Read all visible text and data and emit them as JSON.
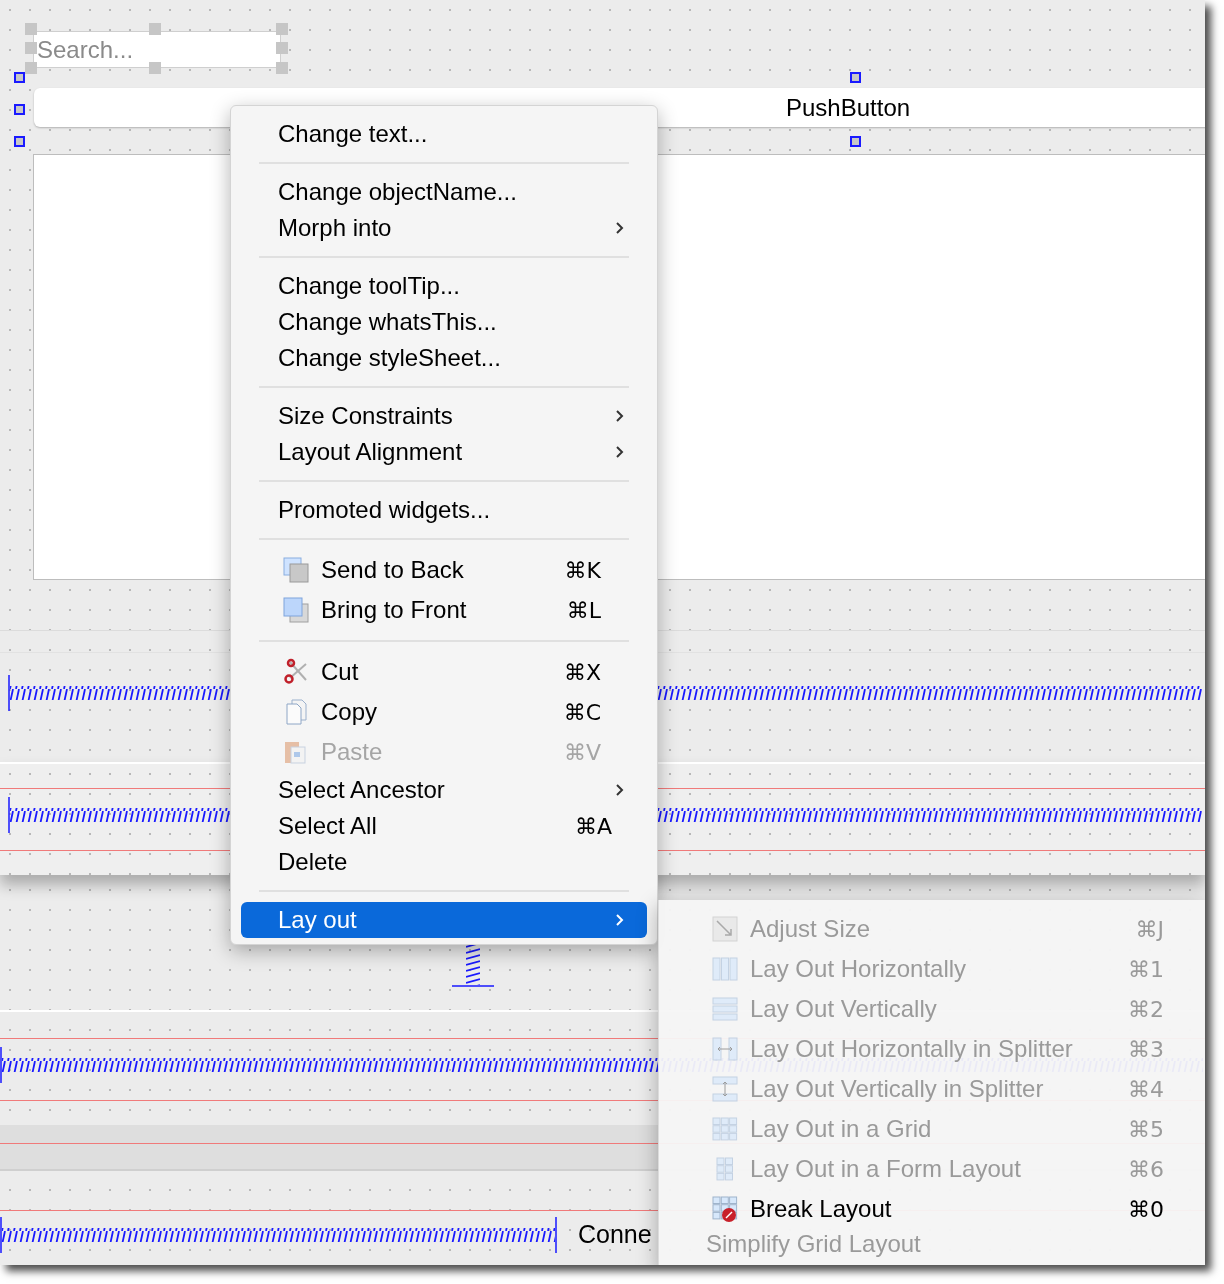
{
  "search_field": {
    "placeholder": "Search..."
  },
  "push_button": {
    "label": "PushButton"
  },
  "status_label": {
    "text": "Conne"
  },
  "context_menu": {
    "sections": [
      {
        "items": [
          {
            "kind": "text",
            "label": "Change text...",
            "submenu": false,
            "disabled": false,
            "selected": false
          }
        ]
      },
      {
        "items": [
          {
            "kind": "text",
            "label": "Change objectName...",
            "submenu": false,
            "disabled": false,
            "selected": false
          },
          {
            "kind": "text",
            "label": "Morph into",
            "submenu": true,
            "disabled": false,
            "selected": false
          }
        ]
      },
      {
        "items": [
          {
            "kind": "text",
            "label": "Change toolTip...",
            "submenu": false,
            "disabled": false,
            "selected": false
          },
          {
            "kind": "text",
            "label": "Change whatsThis...",
            "submenu": false,
            "disabled": false,
            "selected": false
          },
          {
            "kind": "text",
            "label": "Change styleSheet...",
            "submenu": false,
            "disabled": false,
            "selected": false
          }
        ]
      },
      {
        "items": [
          {
            "kind": "text",
            "label": "Size Constraints",
            "submenu": true,
            "disabled": false,
            "selected": false
          },
          {
            "kind": "text",
            "label": "Layout Alignment",
            "submenu": true,
            "disabled": false,
            "selected": false
          }
        ]
      },
      {
        "items": [
          {
            "kind": "text",
            "label": "Promoted widgets...",
            "submenu": false,
            "disabled": false,
            "selected": false
          }
        ]
      },
      {
        "items": [
          {
            "kind": "icon",
            "label": "Send to Back",
            "shortcut": "⌘K",
            "submenu": false,
            "disabled": false,
            "selected": false
          },
          {
            "kind": "icon",
            "label": "Bring to Front",
            "shortcut": "⌘L",
            "submenu": false,
            "disabled": false,
            "selected": false
          }
        ]
      },
      {
        "items": [
          {
            "kind": "icon",
            "label": "Cut",
            "shortcut": "⌘X",
            "submenu": false,
            "disabled": false,
            "selected": false
          },
          {
            "kind": "icon",
            "label": "Copy",
            "shortcut": "⌘C",
            "submenu": false,
            "disabled": false,
            "selected": false
          },
          {
            "kind": "icon",
            "label": "Paste",
            "shortcut": "⌘V",
            "submenu": false,
            "disabled": true,
            "selected": false
          },
          {
            "kind": "text",
            "label": "Select Ancestor",
            "submenu": true,
            "disabled": false,
            "selected": false
          },
          {
            "kind": "text",
            "label": "Select All",
            "shortcut": "⌘A",
            "submenu": false,
            "disabled": false,
            "selected": false
          },
          {
            "kind": "text",
            "label": "Delete",
            "submenu": false,
            "disabled": false,
            "selected": false
          }
        ]
      },
      {
        "items": [
          {
            "kind": "text",
            "label": "Lay out",
            "submenu": true,
            "disabled": false,
            "selected": true
          }
        ]
      }
    ]
  },
  "layout_submenu": {
    "items": [
      {
        "kind": "icon",
        "label": "Adjust Size",
        "shortcut": "⌘J",
        "disabled": true
      },
      {
        "kind": "icon",
        "label": "Lay Out Horizontally",
        "shortcut": "⌘1",
        "disabled": true
      },
      {
        "kind": "icon",
        "label": "Lay Out Vertically",
        "shortcut": "⌘2",
        "disabled": true
      },
      {
        "kind": "icon",
        "label": "Lay Out Horizontally in Splitter",
        "shortcut": "⌘3",
        "disabled": true
      },
      {
        "kind": "icon",
        "label": "Lay Out Vertically in Splitter",
        "shortcut": "⌘4",
        "disabled": true
      },
      {
        "kind": "icon",
        "label": "Lay Out in a Grid",
        "shortcut": "⌘5",
        "disabled": true
      },
      {
        "kind": "icon",
        "label": "Lay Out in a Form Layout",
        "shortcut": "⌘6",
        "disabled": true
      },
      {
        "kind": "icon",
        "label": "Break Layout",
        "shortcut": "⌘0",
        "disabled": false
      },
      {
        "kind": "text",
        "label": "Simplify Grid Layout",
        "disabled": true
      }
    ]
  }
}
